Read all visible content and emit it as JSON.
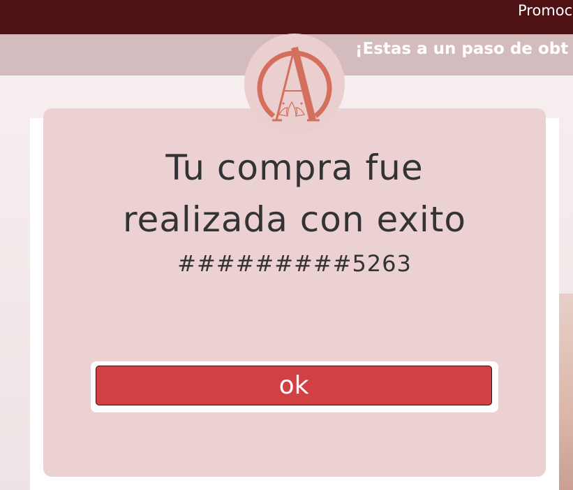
{
  "top_bar": {
    "text": "Promoc"
  },
  "banner": {
    "text": "¡Estas a un paso de obt"
  },
  "logo": {
    "letter": "A",
    "icon": "lotus-logo-icon"
  },
  "modal": {
    "title_line1": "Tu compra fue",
    "title_line2": "realizada con exito",
    "code": "#########5263",
    "ok_label": "ok"
  },
  "colors": {
    "top_bar": "#4e1215",
    "banner": "#d4bbbd",
    "modal": "#ebd1d2",
    "button": "#d14042",
    "logo_mark": "#d46f5d"
  }
}
